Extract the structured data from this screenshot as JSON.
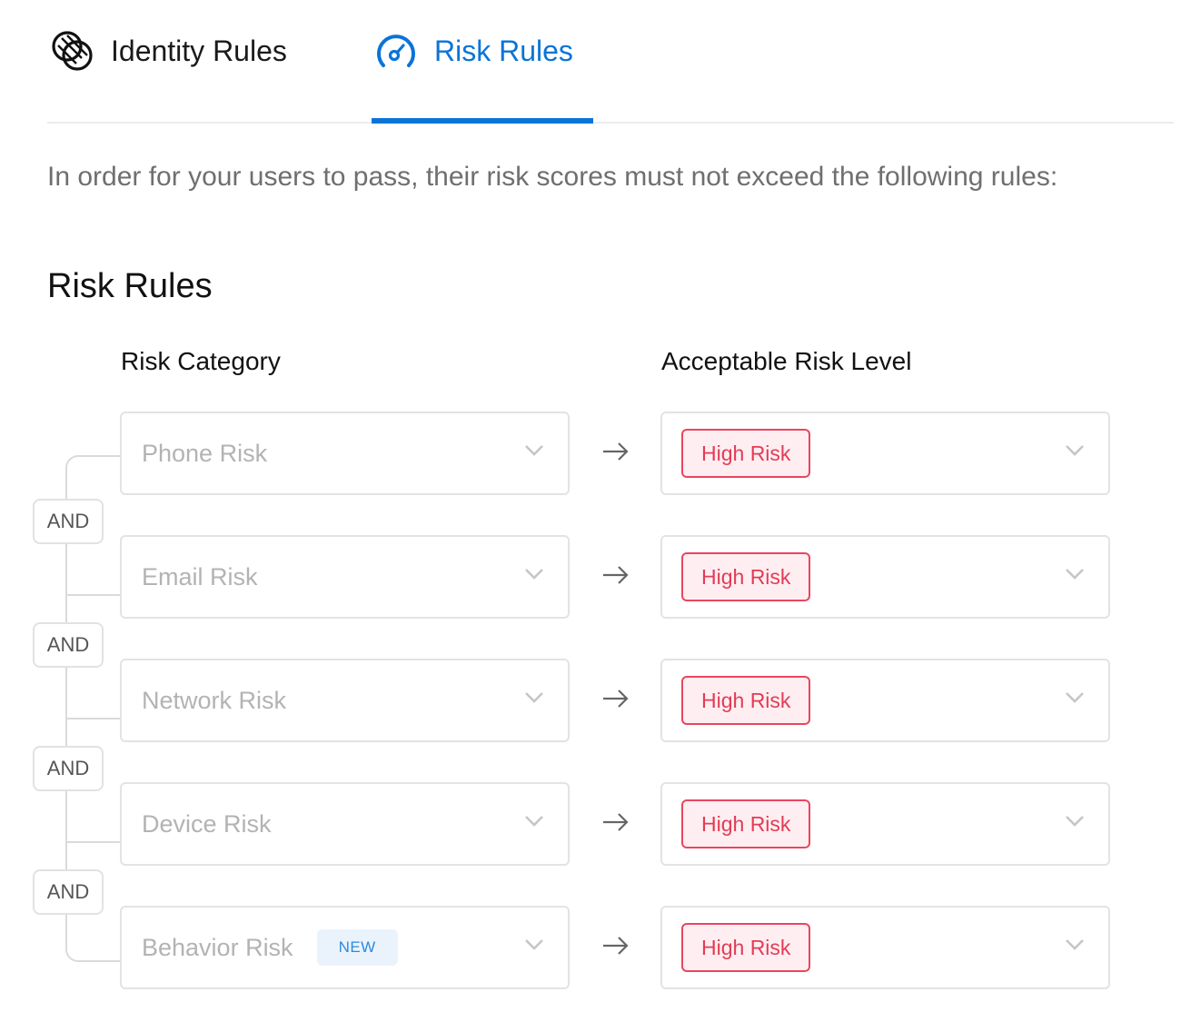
{
  "tabs": [
    {
      "label": "Identity Rules",
      "icon": "circles-icon",
      "active": false
    },
    {
      "label": "Risk Rules",
      "icon": "gauge-icon",
      "active": true
    }
  ],
  "description": "In order for your users to pass, their risk scores must not exceed the following rules:",
  "section_title": "Risk Rules",
  "columns": {
    "category": "Risk Category",
    "level": "Acceptable Risk Level"
  },
  "rows": [
    {
      "category": "Phone Risk",
      "badge": "",
      "level": "High Risk"
    },
    {
      "category": "Email Risk",
      "badge": "",
      "level": "High Risk"
    },
    {
      "category": "Network Risk",
      "badge": "",
      "level": "High Risk"
    },
    {
      "category": "Device Risk",
      "badge": "",
      "level": "High Risk"
    },
    {
      "category": "Behavior Risk",
      "badge": "NEW",
      "level": "High Risk"
    }
  ],
  "operators": [
    "AND",
    "AND",
    "AND",
    "AND"
  ],
  "colors": {
    "accent": "#0a74d8",
    "risk_high": "#e23c55",
    "new_badge": "#2b8ae0"
  }
}
